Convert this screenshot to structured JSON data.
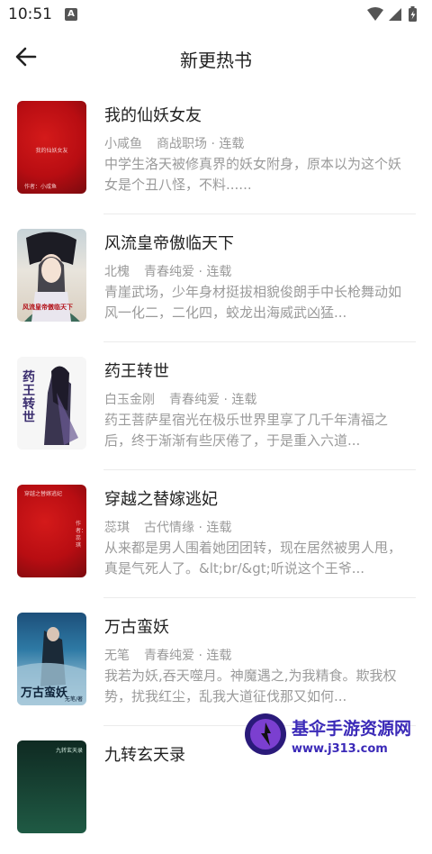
{
  "status": {
    "time": "10:51",
    "notif_glyph": "A"
  },
  "header": {
    "title": "新更热书"
  },
  "books": [
    {
      "title": "我的仙妖女友",
      "author": "小咸鱼",
      "category": "商战职场",
      "status": "连载",
      "desc": "中学生洛天被修真界的妖女附身，原本以为这个妖女是个丑八怪，不料......",
      "cover_text": "我的仙妖女友",
      "cover_author": "作者：小咸鱼"
    },
    {
      "title": "风流皇帝傲临天下",
      "author": "北槐",
      "category": "青春纯爱",
      "status": "连载",
      "desc": "青崖武场，少年身材挺拔相貌俊朗手中长枪舞动如风一化二，二化四，蛟龙出海威武凶猛...",
      "cover_text": "风流皇帝傲临天下"
    },
    {
      "title": "药王转世",
      "author": "白玉金刚",
      "category": "青春纯爱",
      "status": "连载",
      "desc": "药王菩萨星宿光在极乐世界里享了几千年清福之后，终于渐渐有些厌倦了，于是重入六道...",
      "cover_text": "药王转世"
    },
    {
      "title": "穿越之替嫁逃妃",
      "author": "蕊琪",
      "category": "古代情缘",
      "status": "连载",
      "desc": "从来都是男人围着她团团转，现在居然被男人甩，真是气死人了。&lt;br/&gt;听说这个王爷...",
      "cover_text": "穿越之替嫁逃妃",
      "cover_author": "作者：蕊琪"
    },
    {
      "title": "万古蛮妖",
      "author": "无笔",
      "category": "青春纯爱",
      "status": "连载",
      "desc": "我若为妖,吞天噬月。神魔遇之,为我精食。欺我权势，扰我红尘，乱我大道征伐那又如何...",
      "cover_text": "万古蛮妖",
      "cover_author": "无笔/著"
    },
    {
      "title": "九转玄天录",
      "author": "",
      "category": "",
      "status": "",
      "desc": "",
      "cover_text": "九转玄天录"
    }
  ],
  "watermark": {
    "title": "基伞手游资源网",
    "url": "www.j313.com"
  },
  "colors": {
    "accent_red": "#c0121a",
    "watermark": "#3b2ab8",
    "muted": "#9a9a9a"
  }
}
